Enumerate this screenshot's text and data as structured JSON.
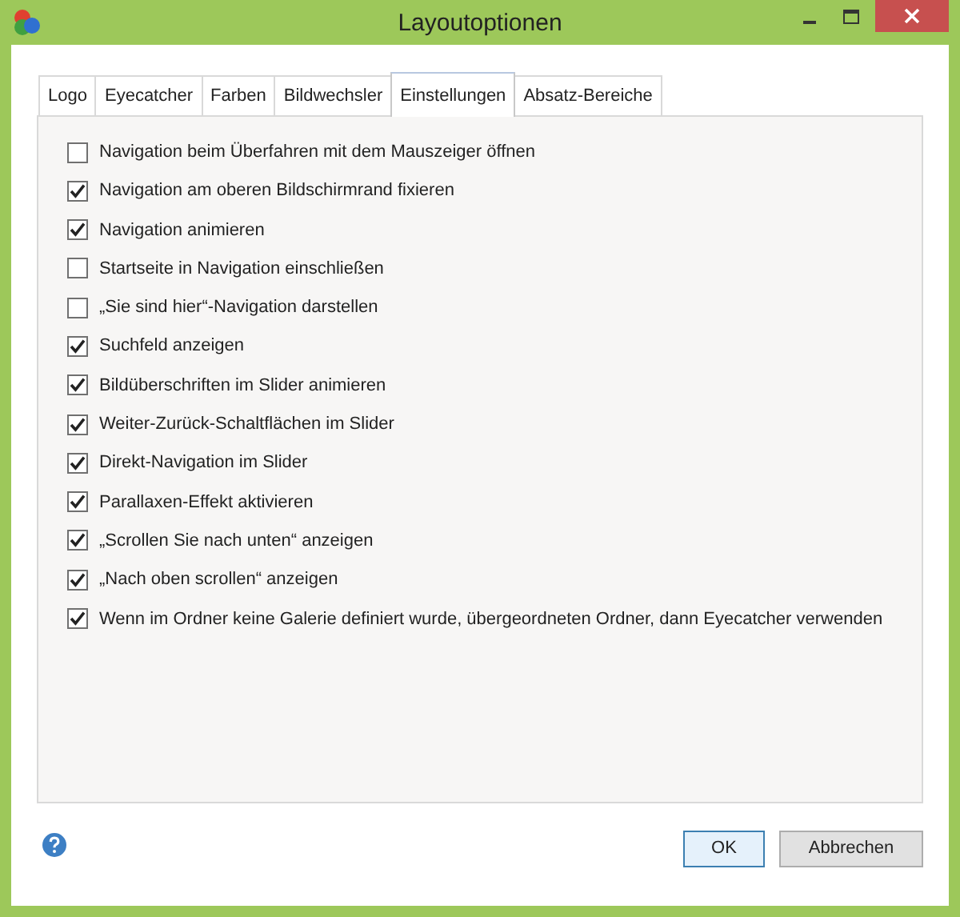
{
  "window": {
    "title": "Layoutoptionen"
  },
  "tabs": [
    {
      "label": "Logo",
      "selected": false
    },
    {
      "label": "Eyecatcher",
      "selected": false
    },
    {
      "label": "Farben",
      "selected": false
    },
    {
      "label": "Bildwechsler",
      "selected": false
    },
    {
      "label": "Einstellungen",
      "selected": true
    },
    {
      "label": "Absatz-Bereiche",
      "selected": false
    }
  ],
  "options": [
    {
      "label": "Navigation beim Überfahren mit dem Mauszeiger öffnen",
      "checked": false
    },
    {
      "label": "Navigation am oberen Bildschirmrand fixieren",
      "checked": true
    },
    {
      "label": "Navigation animieren",
      "checked": true
    },
    {
      "label": "Startseite in Navigation einschließen",
      "checked": false
    },
    {
      "label": "„Sie sind hier“-Navigation darstellen",
      "checked": false
    },
    {
      "label": "Suchfeld anzeigen",
      "checked": true
    },
    {
      "label": "Bildüberschriften im Slider animieren",
      "checked": true
    },
    {
      "label": "Weiter-Zurück-Schaltflächen im Slider",
      "checked": true
    },
    {
      "label": "Direkt-Navigation im Slider",
      "checked": true
    },
    {
      "label": "Parallaxen-Effekt aktivieren",
      "checked": true
    },
    {
      "label": "„Scrollen Sie nach unten“ anzeigen",
      "checked": true
    },
    {
      "label": "„Nach oben scrollen“ anzeigen",
      "checked": true
    },
    {
      "label": "Wenn im Ordner keine Galerie definiert wurde, übergeordneten Ordner, dann Eyecatcher verwenden",
      "checked": true
    }
  ],
  "buttons": [
    {
      "label": "OK",
      "default": true
    },
    {
      "label": "Abbrechen",
      "default": false
    }
  ]
}
